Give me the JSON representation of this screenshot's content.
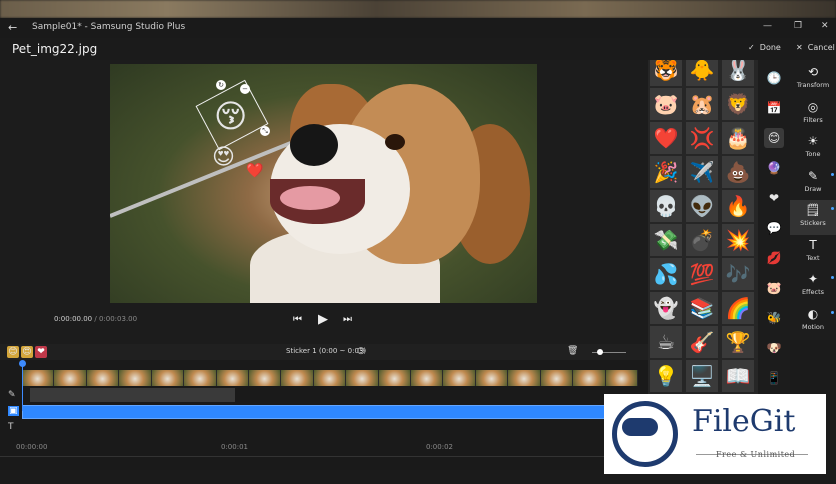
{
  "window": {
    "title": "Sample01* - Samsung Studio Plus",
    "back_icon": "←",
    "minimize": "—",
    "maximize": "❐",
    "close": "✕"
  },
  "header": {
    "filename": "Pet_img22.jpg",
    "done_label": "Done",
    "cancel_label": "Cancel",
    "done_icon": "✓",
    "cancel_icon": "✕"
  },
  "player": {
    "current_time": "0:00:00.00",
    "separator": "/",
    "total_time": "0:00:03.00",
    "prev_icon": "⏮",
    "play_icon": "▶",
    "next_icon": "⏭"
  },
  "timeline": {
    "sticker_label": "Sticker 1 (0:00 ~ 0:03)",
    "mini_stickers": [
      "😊",
      "😍",
      "❤"
    ],
    "zoom_level": 0.2,
    "ruler": [
      "00:00:00",
      "0:00:01",
      "0:00:02"
    ],
    "sticker_clip_fill": 1.0
  },
  "canvas_stickers": [
    "😚",
    "😍",
    "❤️"
  ],
  "sticker_grid": [
    "🐯",
    "🐥",
    "🐰",
    "🐷",
    "🐹",
    "🦁",
    "❤️",
    "💢",
    "🎂",
    "🎉",
    "✈️",
    "💩",
    "💀",
    "👽",
    "🔥",
    "💸",
    "💣",
    "💥",
    "💦",
    "💯",
    "🎶",
    "👻",
    "📚",
    "🌈",
    "☕",
    "🎸",
    "🏆",
    "💡",
    "🖥️",
    "📖"
  ],
  "categories": [
    "🕒",
    "📅",
    "😊",
    "🔮",
    "❤",
    "💬",
    "💋",
    "🐷",
    "🐝",
    "🐶",
    "📱"
  ],
  "tools": [
    {
      "icon": "⟲",
      "label": "Transform"
    },
    {
      "icon": "◎",
      "label": "Filters"
    },
    {
      "icon": "☀",
      "label": "Tone"
    },
    {
      "icon": "✎",
      "label": "Draw"
    },
    {
      "icon": "🗒",
      "label": "Stickers"
    },
    {
      "icon": "T",
      "label": "Text"
    },
    {
      "icon": "✦",
      "label": "Effects"
    },
    {
      "icon": "◐",
      "label": "Motion"
    }
  ],
  "watermark": {
    "name": "FileGit",
    "tagline": "Free & Unlimited"
  },
  "colors": {
    "accent": "#2f88ff",
    "panel": "#262626",
    "background": "#1b1b1b",
    "logo": "#1e3a6e"
  }
}
